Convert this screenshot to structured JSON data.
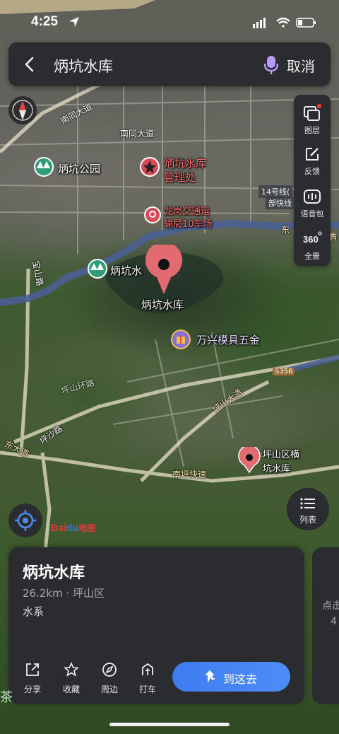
{
  "status_bar": {
    "time": "4:25"
  },
  "search": {
    "query": "炳坑水库",
    "cancel_label": "取消"
  },
  "tools": [
    {
      "label": "图层",
      "icon": "layers-icon"
    },
    {
      "label": "反馈",
      "icon": "edit-icon"
    },
    {
      "label": "语音包",
      "icon": "voice-pack-icon"
    },
    {
      "label": "全景",
      "icon": "panorama-360-icon"
    }
  ],
  "map": {
    "pois": {
      "park": "炳坑公园",
      "office_line1": "炳坑水库",
      "office_line2": "管理处",
      "bus_line1": "龙岗交通运",
      "bus_line2": "输局10车场",
      "reservoir_partial": "炳坑水",
      "selected": "炳坑水库",
      "hardware": "万兴模具五金",
      "pingshan_line1": "坪山区横",
      "pingshan_line2": "坑水库"
    },
    "roads": {
      "nantong_1": "南同大道",
      "nantong_2": "南同大道",
      "baoshan": "宝山路",
      "pingshan_ring": "坪山环路",
      "pingsha": "坪沙路",
      "dong_dadao": "东大道",
      "pingshan_dadao": "坪山大道",
      "nanping": "南坪快速",
      "dong": "东",
      "qing": "青"
    },
    "line14_line1": "14号线(",
    "line14_line2": "部快线",
    "highway_badge": "S356",
    "logo_text": "Bai",
    "logo_text2": "地图"
  },
  "list_button_label": "列表",
  "card": {
    "title": "炳坑水库",
    "meta": "26.2km · 坪山区",
    "category": "水系",
    "actions": [
      {
        "label": "分享",
        "icon": "share-icon"
      },
      {
        "label": "收藏",
        "icon": "star-icon"
      },
      {
        "label": "周边",
        "icon": "compass-icon"
      },
      {
        "label": "打车",
        "icon": "taxi-icon"
      }
    ],
    "go_label": "到这去"
  },
  "side_card": {
    "line1": "点击",
    "line2": "4"
  },
  "left_edge_text": "茶",
  "colors": {
    "panel": "#2b2c30",
    "accent": "#4e8cf7",
    "pin": "#e26b72",
    "river": "#4a5f93"
  }
}
